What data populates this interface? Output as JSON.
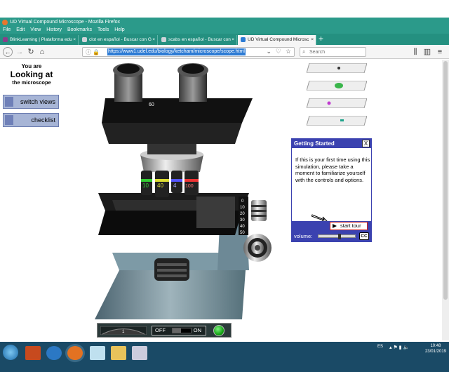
{
  "window": {
    "title": "UD Virtual Compound Microscope - Mozilla Firefox"
  },
  "menu": [
    "File",
    "Edit",
    "View",
    "History",
    "Bookmarks",
    "Tools",
    "Help"
  ],
  "tabs": [
    {
      "label": "BlinkLearning | Plataforma edu",
      "icon_color": "#8a3e8a"
    },
    {
      "label": "clot en español - Buscar con G",
      "icon_color": "#cfd4da"
    },
    {
      "label": "scabs en español - Buscar con",
      "icon_color": "#cfd4da"
    },
    {
      "label": "UD Virtual Compound Microsc",
      "icon_color": "#2d7bd4",
      "active": true
    }
  ],
  "nav": {
    "url": "https://www1.udel.edu/biology/ketcham/microscope/scope.html",
    "search_placeholder": "Search"
  },
  "left_panel": {
    "line1": "You are",
    "line2": "Looking at",
    "line3": "the microscope",
    "switch_views": "switch views",
    "checklist": "checklist"
  },
  "microscope": {
    "objectives": [
      "10",
      "40",
      "4",
      "100"
    ],
    "eyepiece_scale": "60",
    "stage_scale": [
      "0",
      "10",
      "20",
      "30",
      "40",
      "50"
    ],
    "light_off": "OFF",
    "light_on": "ON",
    "dial_mark": "1"
  },
  "slides": [
    {
      "name": "slide-1",
      "dot": "#333"
    },
    {
      "name": "slide-2",
      "dot": "#39b54a"
    },
    {
      "name": "slide-3",
      "dot": "#c03ad0"
    },
    {
      "name": "slide-4",
      "dot": "#1da38a"
    }
  ],
  "getting_started": {
    "title": "Getting Started",
    "close": "X",
    "body": "If this  is your first time using this simulation, please take a moment to familiarize yourself with the controls and options.",
    "tour_button": "start tour",
    "volume_label": "volume:",
    "volume_level": 0.55,
    "cc": "CC"
  },
  "taskbar": {
    "lang": "ES",
    "time": "10:48",
    "date": "23/01/2019"
  },
  "colors": {
    "firefox_teal": "#2b9a8a",
    "panel_blue": "#3b42b0",
    "button_blue": "#a7b5d6",
    "lamp_green": "#16a516"
  }
}
